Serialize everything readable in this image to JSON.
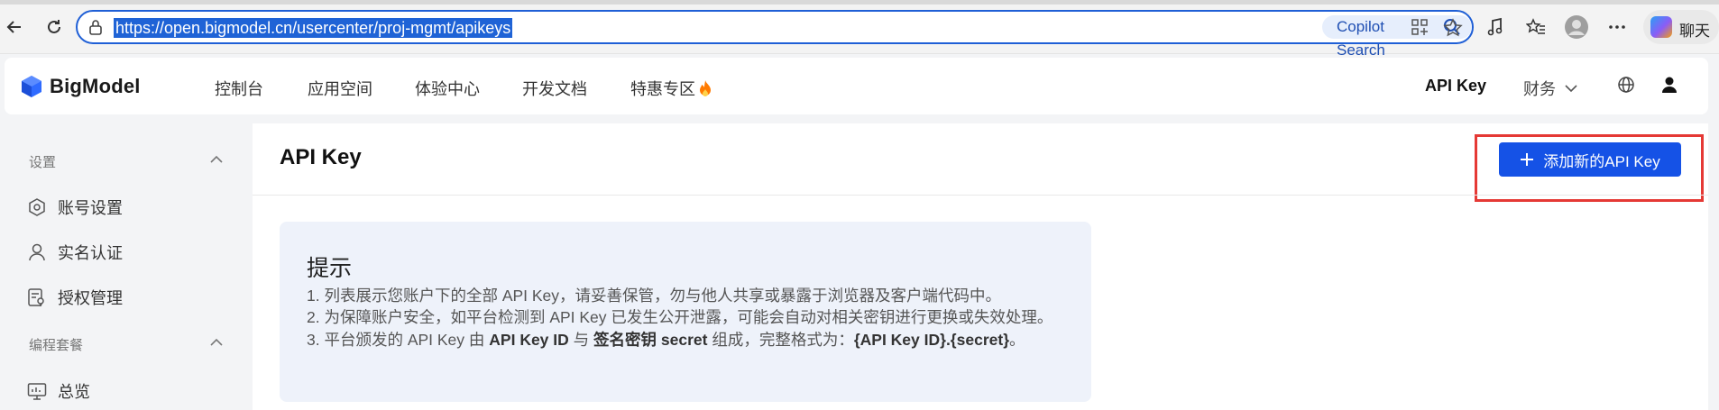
{
  "browser": {
    "url": "https://open.bigmodel.cn/usercenter/proj-mgmt/apikeys",
    "copilot_search_label": "Copilot Search",
    "chat_label": "聊天"
  },
  "header": {
    "logo_text": "BigModel",
    "nav": [
      "控制台",
      "应用空间",
      "体验中心",
      "开发文档",
      "特惠专区"
    ],
    "api_key_label": "API Key",
    "finance_label": "财务"
  },
  "sidebar": {
    "section_settings": "设置",
    "items_settings": [
      {
        "label": "账号设置",
        "icon": "hexagon-settings-icon"
      },
      {
        "label": "实名认证",
        "icon": "user-icon"
      },
      {
        "label": "授权管理",
        "icon": "authorization-icon"
      }
    ],
    "section_coding": "编程套餐",
    "items_coding": [
      {
        "label": "总览",
        "icon": "monitor-chart-icon"
      }
    ]
  },
  "main": {
    "title": "API Key",
    "add_button_label": "添加新的API Key",
    "tip": {
      "title": "提示",
      "line1": "1. 列表展示您账户下的全部 API Key，请妥善保管，勿与他人共享或暴露于浏览器及客户端代码中。",
      "line2": "2. 为保障账户安全，如平台检测到 API Key 已发生公开泄露，可能会自动对相关密钥进行更换或失效处理。",
      "line3_a": "3. 平台颁发的 API Key 由 ",
      "line3_b": "API Key ID",
      "line3_c": " 与 ",
      "line3_d": "签名密钥 secret",
      "line3_e": " 组成，完整格式为：",
      "line3_f": "{API Key ID}.{secret}",
      "line3_g": "。"
    }
  },
  "colors": {
    "primary": "#1552e6",
    "highlight": "#e53935",
    "tip_bg": "#eef2fa"
  }
}
